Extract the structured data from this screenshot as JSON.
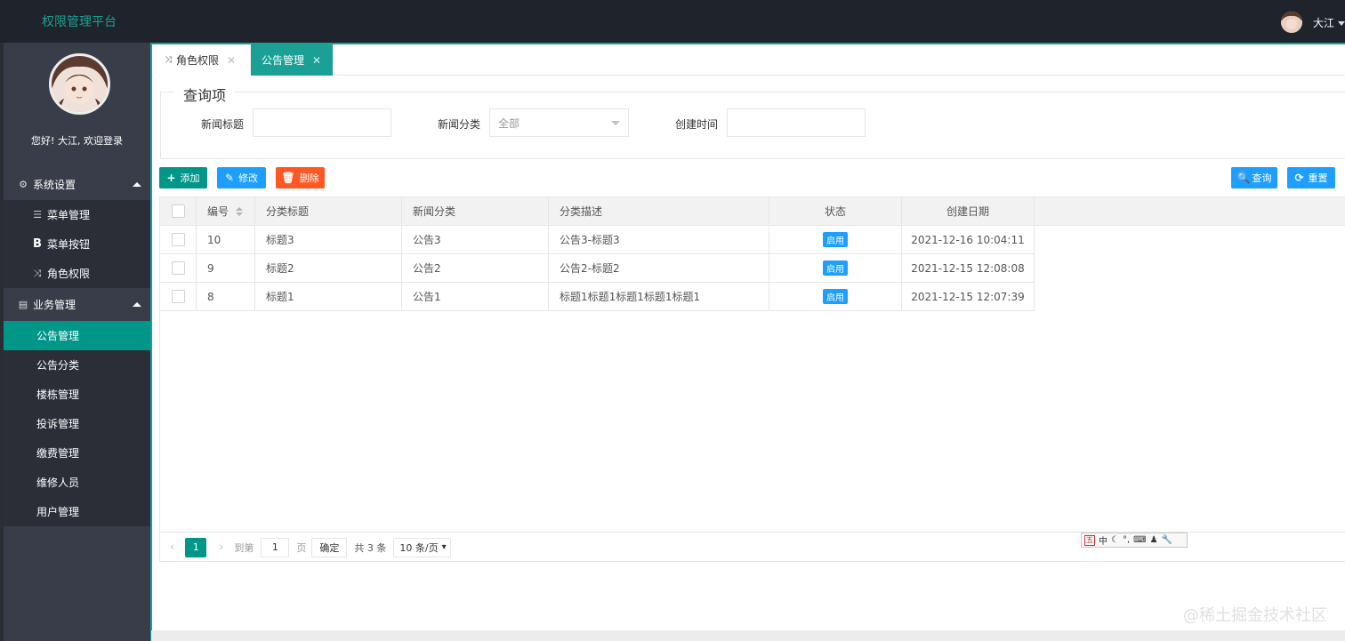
{
  "header": {
    "brand": "权限管理平台",
    "user_name": "大江"
  },
  "sidebar": {
    "welcome": "您好! 大江, 欢迎登录",
    "groups": [
      {
        "label": "系统设置",
        "icon": "gear-icon",
        "items": [
          {
            "label": "菜单管理",
            "icon": "list-icon"
          },
          {
            "label": "菜单按钮",
            "icon": "bold-b-icon"
          },
          {
            "label": "角色权限",
            "icon": "shuffle-icon"
          }
        ]
      },
      {
        "label": "业务管理",
        "icon": "document-icon",
        "items": [
          {
            "label": "公告管理",
            "active": true
          },
          {
            "label": "公告分类"
          },
          {
            "label": "楼栋管理"
          },
          {
            "label": "投诉管理"
          },
          {
            "label": "缴费管理"
          },
          {
            "label": "维修人员"
          },
          {
            "label": "用户管理"
          }
        ]
      }
    ]
  },
  "tabs": [
    {
      "label": "角色权限",
      "icon": "shuffle-icon",
      "active": false
    },
    {
      "label": "公告管理",
      "active": true
    }
  ],
  "query": {
    "legend": "查询项",
    "fields": [
      {
        "label": "新闻标题",
        "value": ""
      },
      {
        "label": "新闻分类",
        "value": "全部"
      },
      {
        "label": "创建时间",
        "value": ""
      }
    ]
  },
  "toolbar": {
    "add": "添加",
    "edit": "修改",
    "delete": "删除",
    "search": "查询",
    "reset": "重置"
  },
  "table": {
    "columns": [
      "编号",
      "分类标题",
      "新闻分类",
      "分类描述",
      "状态",
      "创建日期"
    ],
    "rows": [
      {
        "id": "10",
        "title": "标题3",
        "category": "公告3",
        "desc": "公告3-标题3",
        "status": "启用",
        "created": "2021-12-16 10:04:11"
      },
      {
        "id": "9",
        "title": "标题2",
        "category": "公告2",
        "desc": "公告2-标题2",
        "status": "启用",
        "created": "2021-12-15 12:08:08"
      },
      {
        "id": "8",
        "title": "标题1",
        "category": "公告1",
        "desc": "标题1标题1标题1标题1标题1",
        "status": "启用",
        "created": "2021-12-15 12:07:39"
      }
    ]
  },
  "pager": {
    "current": "1",
    "goto_label": "到第",
    "goto_value": "1",
    "page_unit": "页",
    "confirm": "确定",
    "total": "共 3 条",
    "page_size": "10 条/页"
  },
  "ime": {
    "mode": "中"
  },
  "watermark": "@稀土掘金技术社区",
  "colors": {
    "accent": "#009688",
    "primary": "#1e9fff",
    "danger": "#ff5722",
    "sidebar": "#393d49",
    "header": "#1f232b"
  }
}
